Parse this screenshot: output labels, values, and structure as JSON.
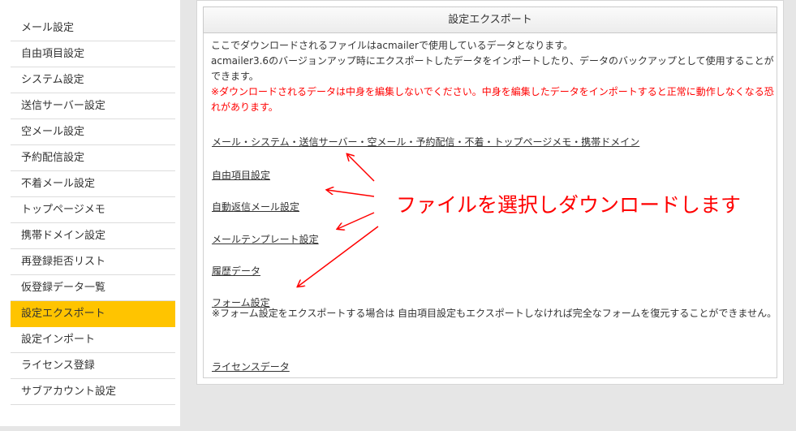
{
  "sidebar": {
    "items": [
      {
        "label": "メール設定"
      },
      {
        "label": "自由項目設定"
      },
      {
        "label": "システム設定"
      },
      {
        "label": "送信サーバー設定"
      },
      {
        "label": "空メール設定"
      },
      {
        "label": "予約配信設定"
      },
      {
        "label": "不着メール設定"
      },
      {
        "label": "トップページメモ"
      },
      {
        "label": "携帯ドメイン設定"
      },
      {
        "label": "再登録拒否リスト"
      },
      {
        "label": "仮登録データ一覧"
      },
      {
        "label": "設定エクスポート",
        "active": true
      },
      {
        "label": "設定インポート"
      },
      {
        "label": "ライセンス登録"
      },
      {
        "label": "サブアカウント設定"
      }
    ]
  },
  "panel": {
    "title": "設定エクスポート",
    "intro_1": "ここでダウンロードされるファイルはacmailerで使用しているデータとなります。",
    "intro_2": "acmailer3.6のバージョンアップ時にエクスポートしたデータをインポートしたり、データのバックアップとして使用することができます。",
    "warning": "※ダウンロードされるデータは中身を編集しないでください。中身を編集したデータをインポートすると正常に動作しなくなる恐れがあります。",
    "links": [
      {
        "label": "メール・システム・送信サーバー・空メール・予約配信・不着・トップページメモ・携帯ドメイン"
      },
      {
        "label": "自由項目設定"
      },
      {
        "label": "自動返信メール設定"
      },
      {
        "label": "メールテンプレート設定"
      },
      {
        "label": "履歴データ"
      },
      {
        "label": "フォーム設定"
      },
      {
        "label": "ライセンスデータ"
      }
    ],
    "form_note": "※フォーム設定をエクスポートする場合は 自由項目設定もエクスポートしなければ完全なフォームを復元することができません。"
  },
  "annotation": {
    "callout": "ファイルを選択しダウンロードします",
    "color": "#ff0000"
  },
  "colors": {
    "active_item": "#ffc400",
    "warning_text": "#ff0000"
  }
}
